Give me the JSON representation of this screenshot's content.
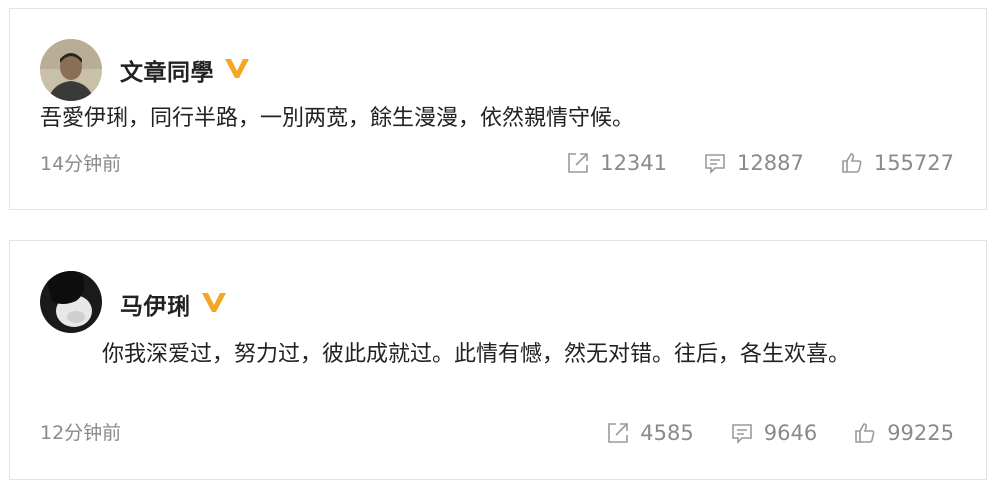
{
  "posts": [
    {
      "username": "文章同學",
      "verified_icon": "verified-v-badge",
      "verified_color": "#f5a623",
      "text": "吾愛伊琍，同行半路，一別两宽，餘生漫漫，依然親情守候。",
      "time": "14分钟前",
      "repost_count": "12341",
      "comment_count": "12887",
      "like_count": "155727"
    },
    {
      "username": "马伊琍",
      "verified_icon": "verified-v-badge",
      "verified_color": "#f5a623",
      "text": "你我深爱过，努力过，彼此成就过。此情有憾，然无对错。往后，各生欢喜。",
      "time": "12分钟前",
      "repost_count": "4585",
      "comment_count": "9646",
      "like_count": "99225"
    }
  ],
  "icons": {
    "repost": "share-arrow-icon",
    "comment": "comment-bubble-icon",
    "like": "thumbs-up-icon"
  }
}
